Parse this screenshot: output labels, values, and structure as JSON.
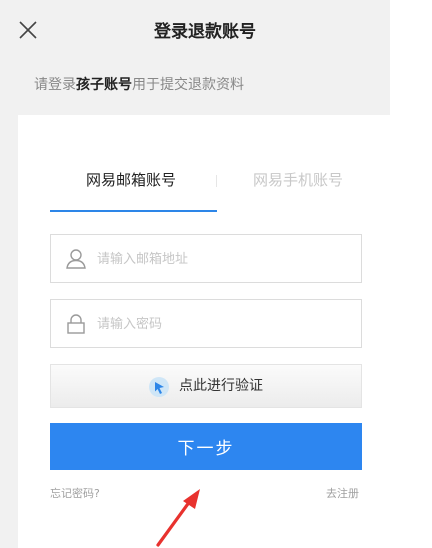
{
  "header": {
    "title": "登录退款账号",
    "close_icon": "close-icon"
  },
  "notice": {
    "prefix": "请登录",
    "highlight": "孩子账号",
    "suffix": "用于提交退款资料"
  },
  "tabs": [
    {
      "label": "网易邮箱账号",
      "active": true
    },
    {
      "label": "网易手机账号",
      "active": false
    }
  ],
  "form": {
    "email_placeholder": "请输入邮箱地址",
    "email_icon": "user-icon",
    "password_placeholder": "请输入密码",
    "password_icon": "lock-icon"
  },
  "verify": {
    "label": "点此进行验证",
    "icon": "captcha-icon"
  },
  "next_label": "下一步",
  "links": {
    "forgot": "忘记密码?",
    "register": "去注册"
  },
  "colors": {
    "accent": "#2d86f0",
    "header_bg": "#f1f1f1",
    "annotation_arrow": "#e8322e"
  }
}
